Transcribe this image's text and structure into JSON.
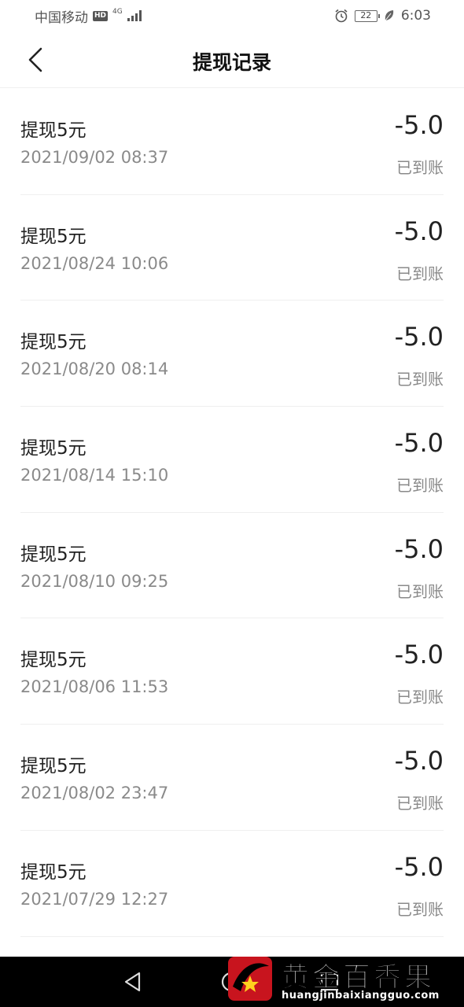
{
  "status_bar": {
    "carrier": "中国移动",
    "hd_badge": "HD",
    "network": "4G",
    "battery": "22",
    "time": "6:03"
  },
  "header": {
    "title": "提现记录"
  },
  "records": [
    {
      "title": "提现5元",
      "time": "2021/09/02 08:37",
      "amount": "-5.0",
      "status": "已到账"
    },
    {
      "title": "提现5元",
      "time": "2021/08/24 10:06",
      "amount": "-5.0",
      "status": "已到账"
    },
    {
      "title": "提现5元",
      "time": "2021/08/20 08:14",
      "amount": "-5.0",
      "status": "已到账"
    },
    {
      "title": "提现5元",
      "time": "2021/08/14 15:10",
      "amount": "-5.0",
      "status": "已到账"
    },
    {
      "title": "提现5元",
      "time": "2021/08/10 09:25",
      "amount": "-5.0",
      "status": "已到账"
    },
    {
      "title": "提现5元",
      "time": "2021/08/06 11:53",
      "amount": "-5.0",
      "status": "已到账"
    },
    {
      "title": "提现5元",
      "time": "2021/08/02 23:47",
      "amount": "-5.0",
      "status": "已到账"
    },
    {
      "title": "提现5元",
      "time": "2021/07/29 12:27",
      "amount": "-5.0",
      "status": "已到账"
    }
  ],
  "watermark": {
    "brand": "黄金百香果",
    "url": "huangjinbaixiangguo.com"
  },
  "colors": {
    "primary_text": "#222222",
    "secondary_text": "#8a8a8a",
    "divider": "#efefef",
    "nav_bar": "#000000",
    "logo_red": "#c8141e"
  }
}
